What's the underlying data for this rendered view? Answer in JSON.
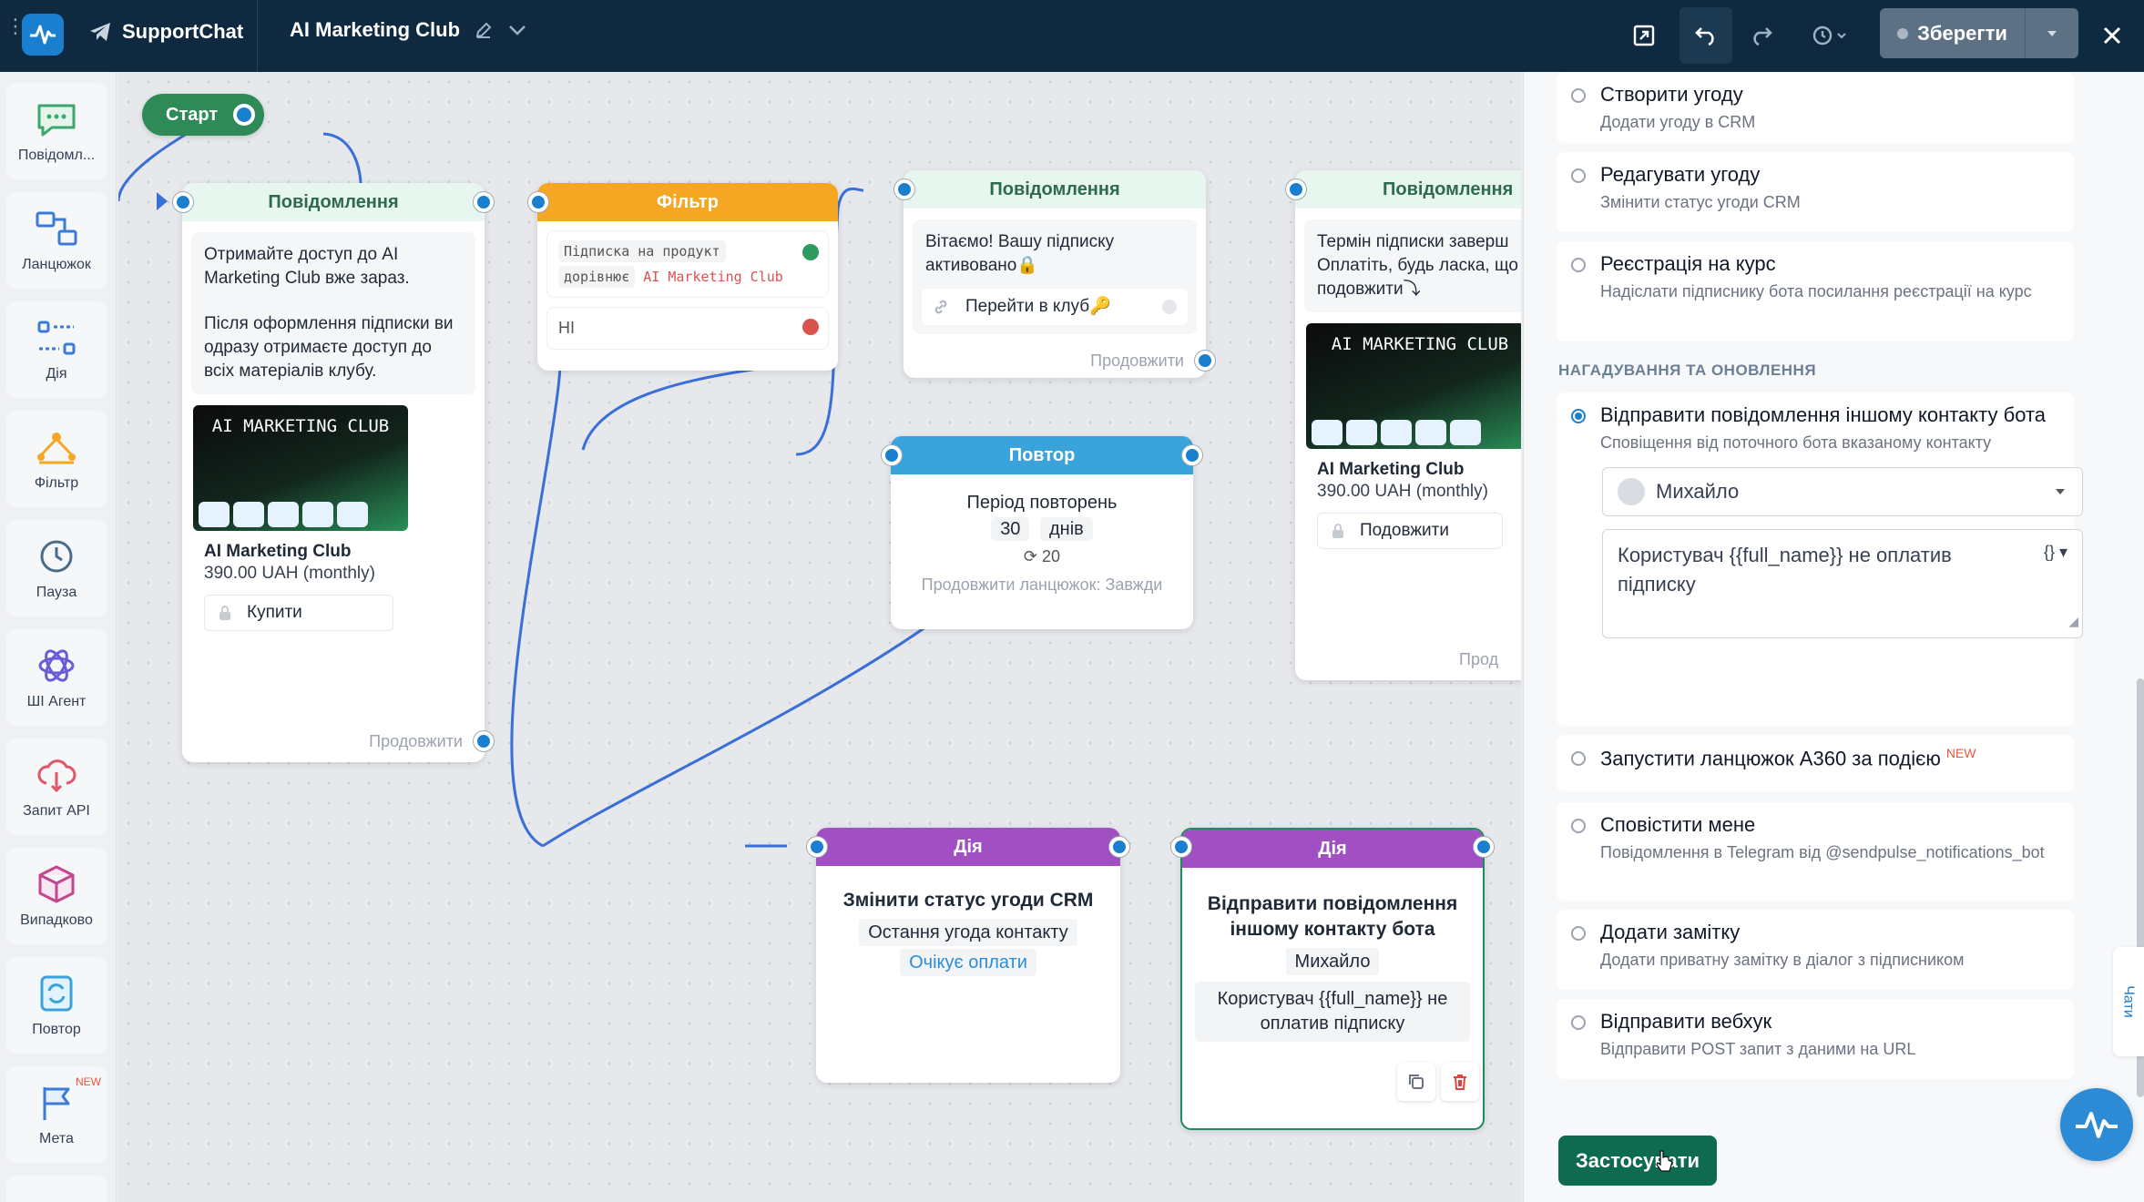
{
  "header": {
    "brand": "SupportChat",
    "flow_name": "AI Marketing Club",
    "save_label": "Зберегти"
  },
  "sidebar": {
    "items": [
      {
        "label": "Повідомл...",
        "icon": "message-icon"
      },
      {
        "label": "Ланцюжок",
        "icon": "chain-icon"
      },
      {
        "label": "Дія",
        "icon": "action-icon"
      },
      {
        "label": "Фільтр",
        "icon": "filter-icon"
      },
      {
        "label": "Пауза",
        "icon": "clock-icon"
      },
      {
        "label": "ШІ Агент",
        "icon": "ai-agent-icon"
      },
      {
        "label": "Запит API",
        "icon": "api-icon"
      },
      {
        "label": "Випадково",
        "icon": "random-icon"
      },
      {
        "label": "Повтор",
        "icon": "repeat-icon"
      },
      {
        "label": "Мета",
        "icon": "flag-icon",
        "badge": "NEW"
      }
    ]
  },
  "canvas": {
    "start_label": "Старт",
    "continue_label": "Продовжити",
    "msg1": {
      "title": "Повідомлення",
      "text_1": "Отримайте доступ до AI Marketing Club вже зараз.",
      "text_2": "Після оформлення підписки ви одразу отримаєте доступ до всіх матеріалів клубу.",
      "card_image_text": "AI MARKETING CLUB",
      "card_title": "AI Marketing Club",
      "card_price": "390.00 UAH (monthly)",
      "button": "Купити"
    },
    "filter": {
      "title": "Фільтр",
      "cond_1": "Підписка на продукт",
      "cond_2": "дорівнює",
      "cond_value": "AI Marketing Club",
      "no_label": "НІ"
    },
    "msg2": {
      "title": "Повідомлення",
      "text": "Вітаємо! Вашу підписку активовано🔒",
      "button": "Перейти в клуб🔑"
    },
    "msg3": {
      "title": "Повідомлення",
      "text": "Термін підписки заверш Оплатіть, будь ласка, що подовжити⤵",
      "card_image_text": "AI MARKETING CLUB",
      "card_title": "AI Marketing Club",
      "card_price": "390.00 UAH (monthly)",
      "button": "Подовжити",
      "continue": "Прод"
    },
    "repeat": {
      "title": "Повтор",
      "period_label": "Період повторень",
      "period_value": "30",
      "period_unit": "днів",
      "count": "20",
      "continue_chain": "Продовжити ланцюжок: Завжди"
    },
    "action1": {
      "title": "Дія",
      "name": "Змінити статус угоди CRM",
      "detail": "Остання угода контакту",
      "status": "Очікує оплати"
    },
    "action2": {
      "title": "Дія",
      "name": "Відправити повідомлення іншому контакту бота",
      "contact": "Михайло",
      "message": "Користувач {{full_name}} не оплатив підписку"
    }
  },
  "panel": {
    "options": [
      {
        "title": "Створити угоду",
        "desc": "Додати угоду в CRM"
      },
      {
        "title": "Редагувати угоду",
        "desc": "Змінити статус угоди CRM"
      },
      {
        "title": "Реєстрація на курс",
        "desc": "Надіслати підписнику бота посилання реєстрації на курс"
      }
    ],
    "section_title": "НАГАДУВАННЯ ТА ОНОВЛЕННЯ",
    "selected_option": {
      "title": "Відправити повідомлення іншому контакту бота",
      "desc": "Сповіщення від поточного бота вказаному контакту"
    },
    "contact_select": "Михайло",
    "message_value": "Користувач {{full_name}} не оплатив підписку",
    "options_2": [
      {
        "title": "Запустити ланцюжок А360 за подією",
        "badge": "NEW"
      },
      {
        "title": "Сповістити мене",
        "desc": "Повідомлення в Telegram від @sendpulse_notifications_bot"
      },
      {
        "title": "Додати замітку",
        "desc": "Додати приватну замітку в діалог з підписником"
      },
      {
        "title": "Відправити вебхук",
        "desc": "Відправити POST запит з даними на URL"
      }
    ],
    "apply_label": "Застосувати",
    "chats_tab": "Чати"
  },
  "colors": {
    "topbar": "#0f2a40",
    "accent": "#1b7fd0",
    "filter": "#f5a623",
    "repeat": "#3aa3dc",
    "action": "#a150c4",
    "apply": "#0f6b4f"
  }
}
